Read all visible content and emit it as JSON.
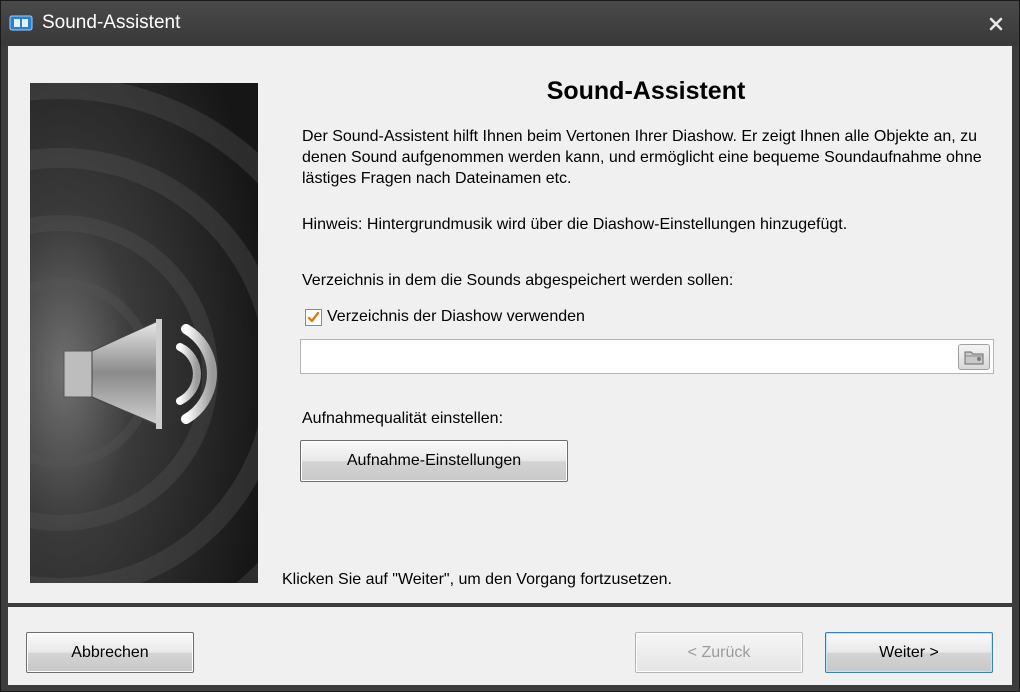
{
  "window": {
    "title": "Sound-Assistent"
  },
  "content": {
    "heading": "Sound-Assistent",
    "intro": "Der Sound-Assistent hilft Ihnen beim Vertonen Ihrer Diashow. Er zeigt Ihnen alle Objekte an, zu denen Sound aufgenommen werden kann, und ermöglicht eine bequeme Soundaufnahme ohne lästiges Fragen nach Dateinamen etc.",
    "hint": "Hinweis: Hintergrundmusik wird über die Diashow-Einstellungen hinzugefügt.",
    "directory_label": "Verzeichnis in dem die Sounds abgespeichert werden sollen:",
    "use_show_directory": {
      "label": "Verzeichnis der Diashow verwenden",
      "checked": true
    },
    "directory_path": {
      "value": "",
      "placeholder": ""
    },
    "quality_label": "Aufnahmequalität einstellen:",
    "recording_settings_button": "Aufnahme-Einstellungen",
    "continue_hint": "Klicken Sie auf \"Weiter\", um den Vorgang fortzusetzen."
  },
  "footer": {
    "cancel_button": "Abbrechen",
    "back_button": "< Zurück",
    "next_button": "Weiter >"
  },
  "icons": {
    "app": "slideshow-icon",
    "close": "close-icon",
    "speaker": "speaker-icon",
    "browse": "folder-icon",
    "check": "checkmark-icon"
  },
  "colors": {
    "checkbox_check": "#e07b10",
    "default_button_border": "#3c7fb1",
    "titlebar": "#404040"
  }
}
